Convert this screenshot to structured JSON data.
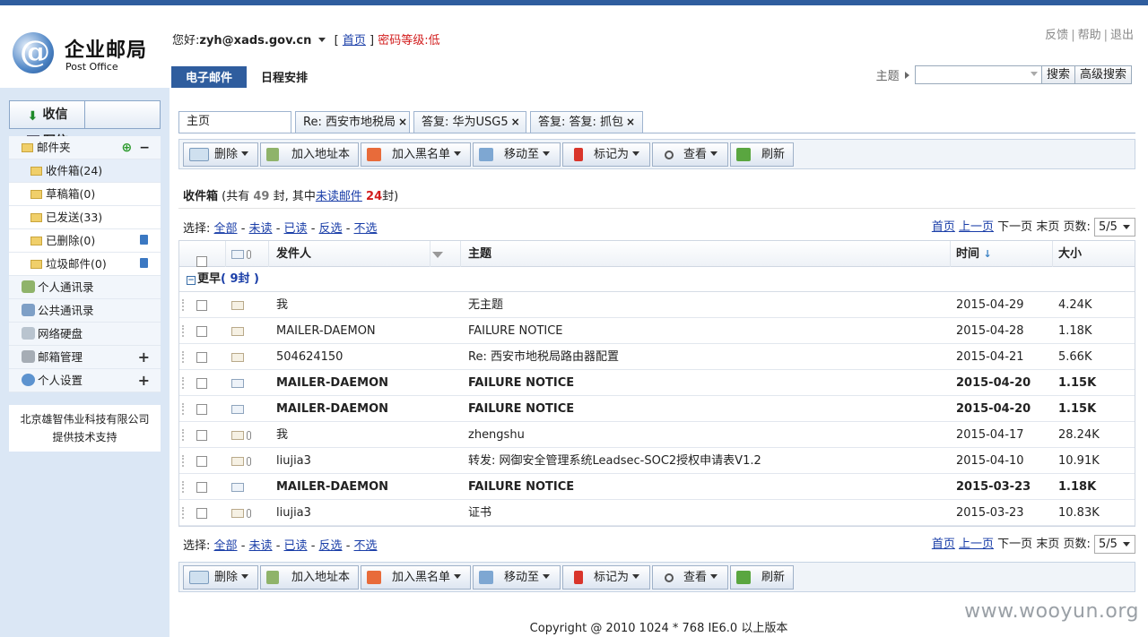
{
  "app": {
    "name_cn": "企业邮局",
    "name_en": "Post Office"
  },
  "header": {
    "greeting": "您好:",
    "email": "zyh@xads.gov.cn",
    "home_link": "首页",
    "bracket_open": "[",
    "bracket_close": "]",
    "pwd_level": "密码等级:低",
    "top_links": [
      "反馈",
      "帮助",
      "退出"
    ],
    "tabs": [
      "电子邮件",
      "日程安排"
    ],
    "search_label": "主题",
    "search_value": "",
    "search_btn": "搜索",
    "adv_search_btn": "高级搜索"
  },
  "sidebar": {
    "receive": "收信",
    "write": "写信",
    "folders_title": "邮件夹",
    "folders": [
      {
        "label": "收件箱(24)"
      },
      {
        "label": "草稿箱(0)"
      },
      {
        "label": "已发送(33)"
      },
      {
        "label": "已删除(0)"
      },
      {
        "label": "垃圾邮件(0)"
      }
    ],
    "sections": [
      "个人通讯录",
      "公共通讯录",
      "网络硬盘",
      "邮箱管理",
      "个人设置"
    ],
    "support_line1": "北京雄智伟业科技有限公司",
    "support_line2": "提供技术支持"
  },
  "tabs": [
    {
      "label": "主页"
    },
    {
      "label": "Re: 西安市地税局"
    },
    {
      "label": "答复: 华为USG5"
    },
    {
      "label": "答复: 答复: 抓包"
    }
  ],
  "toolbar": {
    "delete": "删除",
    "add_contact": "加入地址本",
    "blacklist": "加入黑名单",
    "move": "移动至",
    "mark": "标记为",
    "view": "查看",
    "refresh": "刷新"
  },
  "summary": {
    "folder": "收件箱",
    "p1": "(共有",
    "total": "49",
    "p2": "封, 其中",
    "unread_link": "未读邮件",
    "unread": "24",
    "p3": "封)"
  },
  "select": {
    "label": "选择:",
    "all": "全部",
    "unread": "未读",
    "read": "已读",
    "invert": "反选",
    "none": "不选",
    "dash": "-"
  },
  "pager": {
    "first": "首页",
    "prev": "上一页",
    "next": "下一页",
    "last": "末页",
    "pages_label": "页数:",
    "current": "5/5"
  },
  "table": {
    "headers": {
      "sender": "发件人",
      "subject": "主题",
      "time": "时间",
      "size": "大小"
    },
    "group_label": "更早",
    "group_count": "( 9封 )",
    "rows": [
      {
        "sender": "我",
        "subject": "无主题",
        "time": "2015-04-29",
        "size": "4.24K",
        "unread": false,
        "attach": false
      },
      {
        "sender": "MAILER-DAEMON",
        "subject": "FAILURE NOTICE",
        "time": "2015-04-28",
        "size": "1.18K",
        "unread": false,
        "attach": false
      },
      {
        "sender": "504624150",
        "subject": "Re: 西安市地税局路由器配置",
        "time": "2015-04-21",
        "size": "5.66K",
        "unread": false,
        "attach": false
      },
      {
        "sender": "MAILER-DAEMON",
        "subject": "FAILURE NOTICE",
        "time": "2015-04-20",
        "size": "1.15K",
        "unread": true,
        "attach": false
      },
      {
        "sender": "MAILER-DAEMON",
        "subject": "FAILURE NOTICE",
        "time": "2015-04-20",
        "size": "1.15K",
        "unread": true,
        "attach": false
      },
      {
        "sender": "我",
        "subject": "zhengshu",
        "time": "2015-04-17",
        "size": "28.24K",
        "unread": false,
        "attach": true
      },
      {
        "sender": "liujia3",
        "subject": "转发: 网御安全管理系统Leadsec-SOC2授权申请表V1.2",
        "time": "2015-04-10",
        "size": "10.91K",
        "unread": false,
        "attach": true
      },
      {
        "sender": "MAILER-DAEMON",
        "subject": "FAILURE NOTICE",
        "time": "2015-03-23",
        "size": "1.18K",
        "unread": true,
        "attach": false
      },
      {
        "sender": "liujia3",
        "subject": "证书",
        "time": "2015-03-23",
        "size": "10.83K",
        "unread": false,
        "attach": true
      }
    ]
  },
  "footer": {
    "copyright": "Copyright @ 2010 1024 * 768 IE6.0 以上版本"
  },
  "watermark": "www.wooyun.org"
}
